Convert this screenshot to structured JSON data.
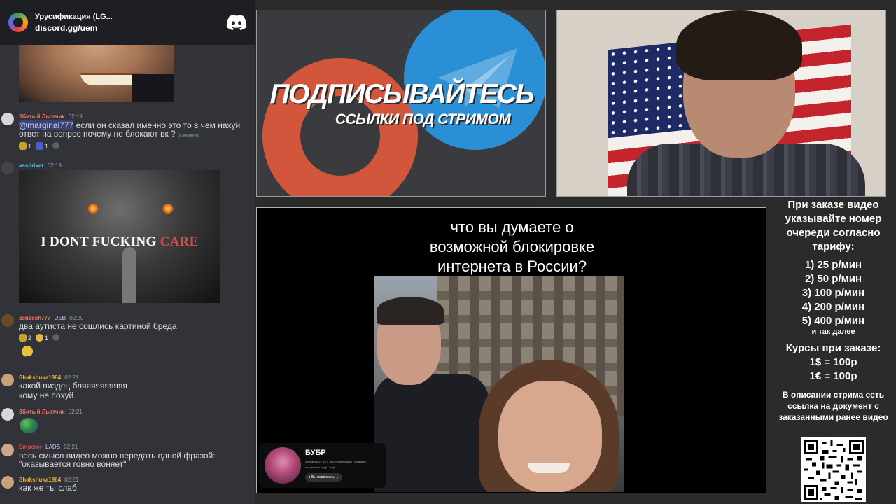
{
  "server": {
    "name": "Урусификация (LG...",
    "invite": "discord.gg/uem"
  },
  "chat": {
    "messages": [
      {
        "user": "Збитый Льотчик",
        "user_color": "#f47b67",
        "time": "02:19",
        "mention": "@marginal777",
        "text": "если он сказал именно это то в чем нахуй ответ на вопрос почему не блокают вк ?",
        "edited": "(изменено)",
        "reactions": [
          {
            "count": "1",
            "color": "#c9a227"
          },
          {
            "count": "1",
            "color": "#4a5bd6"
          }
        ]
      },
      {
        "user": "assdriver",
        "user_color": "#4fc3f7",
        "time": "02:19",
        "meme_text_a": "I DONT FUCKING",
        "meme_text_b": "CARE"
      },
      {
        "user": "ssneech777",
        "user_color": "#f47b67",
        "tag": "UEB",
        "time": "02:20",
        "text": "два аутиста не сошлись картиной бреда",
        "reactions": [
          {
            "count": "2",
            "color": "#c9a227"
          },
          {
            "count": "1",
            "color": "#e8b53f"
          }
        ]
      },
      {
        "user": "Shakshuka1984",
        "user_color": "#f0b232",
        "time": "02:21",
        "text": "какой пиздец бляяяяяяяяяя",
        "text2": "кому не похуй"
      },
      {
        "user": "Збитый Льотчик",
        "user_color": "#f47b67",
        "time": "02:21"
      },
      {
        "user": "Emperor",
        "user_color": "#ed4245",
        "tag": "LADS",
        "time": "02:21",
        "text": "весь смысл видео можно передать одной фразой:",
        "text2": "\"оказывается говно воняет\""
      },
      {
        "user": "Shakshuka1984",
        "user_color": "#f0b232",
        "time": "02:21",
        "text": "как же ты слаб"
      }
    ]
  },
  "promo": {
    "title": "ПОДПИСЫВАЙТЕСЬ",
    "subtitle": "ССЫЛКИ ПОД СТРИМОМ"
  },
  "video": {
    "question_line1": "что вы думаете о",
    "question_line2": "возможной блокировке",
    "question_line3": "интернета в России?",
    "channel_name": "БУБР",
    "channel_stats": "@BUBR192 · 10,4 тыс. подписчиков · 53 видео",
    "channel_about": "по рисовое скуф ...ещё",
    "subscribe_label": "Вы подписаны"
  },
  "info": {
    "notice": "При заказе видео указывайте номер очереди согласно тарифу:",
    "tariffs": [
      "1) 25 р/мин",
      "2) 50 р/мин",
      "3) 100 р/мин",
      "4) 200 р/мин",
      "5) 400 р/мин"
    ],
    "more": "и так далее",
    "rates_title": "Курсы при заказе:",
    "rate_usd": "1$ = 100р",
    "rate_eur": "1€ = 100р",
    "description": "В описании стрима есть ссылка на документ с заказанными ранее видео"
  },
  "colors": {
    "discord_bg": "#313338",
    "server_bar": "#1e1f22",
    "patreon": "#d1563c",
    "telegram": "#2b8fd6"
  }
}
